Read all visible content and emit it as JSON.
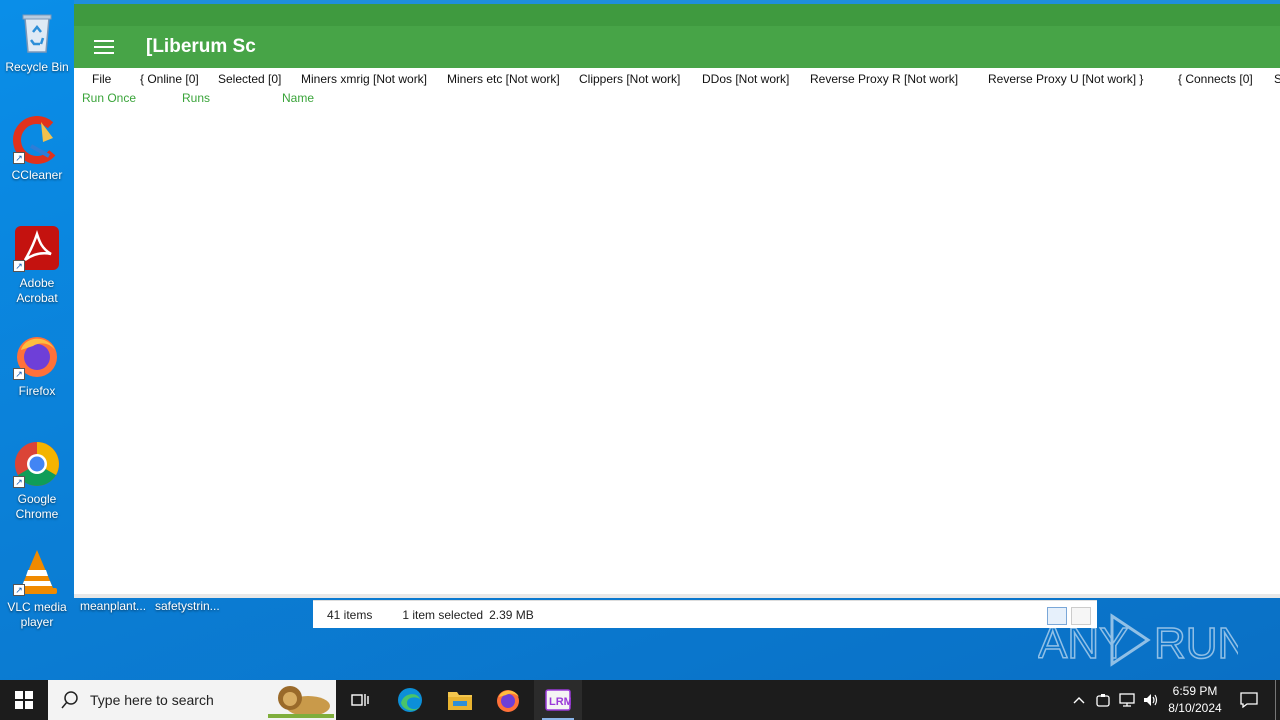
{
  "desktop": {
    "icons": [
      {
        "label": "Recycle Bin"
      },
      {
        "label": "CCleaner"
      },
      {
        "label": "Adobe Acrobat"
      },
      {
        "label": "Firefox"
      },
      {
        "label": "Google Chrome"
      },
      {
        "label": "VLC media player"
      }
    ],
    "files": [
      {
        "label": "meanplant..."
      },
      {
        "label": "safetystrin..."
      }
    ]
  },
  "explorer_status": {
    "items_count": "41 items",
    "selected": "1 item selected",
    "size": "2.39 MB"
  },
  "app": {
    "title": "[Liberum Sc",
    "menu": [
      {
        "label": "File"
      },
      {
        "label": "{ Online [0]"
      },
      {
        "label": "Selected [0]"
      },
      {
        "label": "Miners xmrig [Not work]"
      },
      {
        "label": "Miners etc [Not work]"
      },
      {
        "label": "Clippers [Not work]"
      },
      {
        "label": "DDos [Not work]"
      },
      {
        "label": "Reverse Proxy R [Not work]"
      },
      {
        "label": "Reverse Proxy U [Not work] }"
      },
      {
        "label": "{ Connects [0]"
      },
      {
        "label": "S"
      }
    ],
    "columns": [
      {
        "label": "Run Once"
      },
      {
        "label": "Runs"
      },
      {
        "label": "Name"
      }
    ],
    "header_color": "#47a447",
    "column_color": "#3aa43a"
  },
  "watermark": {
    "text": "ANY RUN"
  },
  "taskbar": {
    "search_placeholder": "Type here to search",
    "time": "6:59 PM",
    "date": "8/10/2024",
    "apps": [
      "task-view",
      "edge",
      "file-explorer",
      "firefox",
      "liberum-rm"
    ]
  }
}
